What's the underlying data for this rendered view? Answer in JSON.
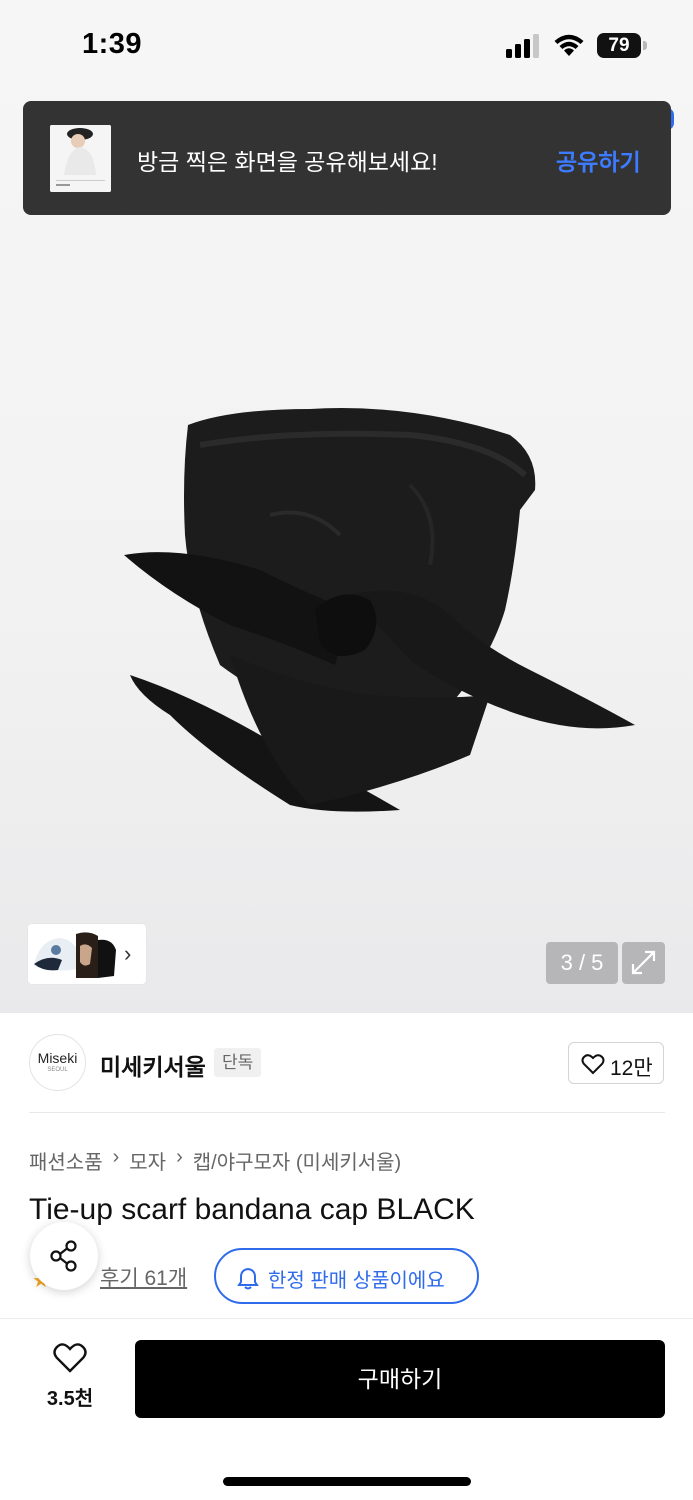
{
  "status_bar": {
    "time": "1:39",
    "battery": "79"
  },
  "toast": {
    "message": "방금 찍은 화면을 공유해보세요!",
    "action": "공유하기"
  },
  "gallery": {
    "counter": "3 / 5",
    "thumb_arrow": "›"
  },
  "brand": {
    "logo_line1": "Miseki",
    "logo_line2": "SEOUL",
    "name": "미세키서울",
    "badge": "단독",
    "likes": "12만"
  },
  "breadcrumb": [
    "패션소품",
    "모자",
    "캡/야구모자 (미세키서울)"
  ],
  "breadcrumb_separator": "›",
  "product": {
    "title": "Tie-up scarf bandana cap BLACK"
  },
  "reviews": {
    "label": "후기 61개"
  },
  "limited": {
    "label": "한정 판매 상품이에요"
  },
  "bottom_bar": {
    "wish_count": "3.5천",
    "buy_label": "구매하기"
  },
  "colors": {
    "accent": "#2f6bea",
    "toast_bg": "#333334",
    "buy_bg": "#000000",
    "counter_bg": "#b6b6b8"
  }
}
